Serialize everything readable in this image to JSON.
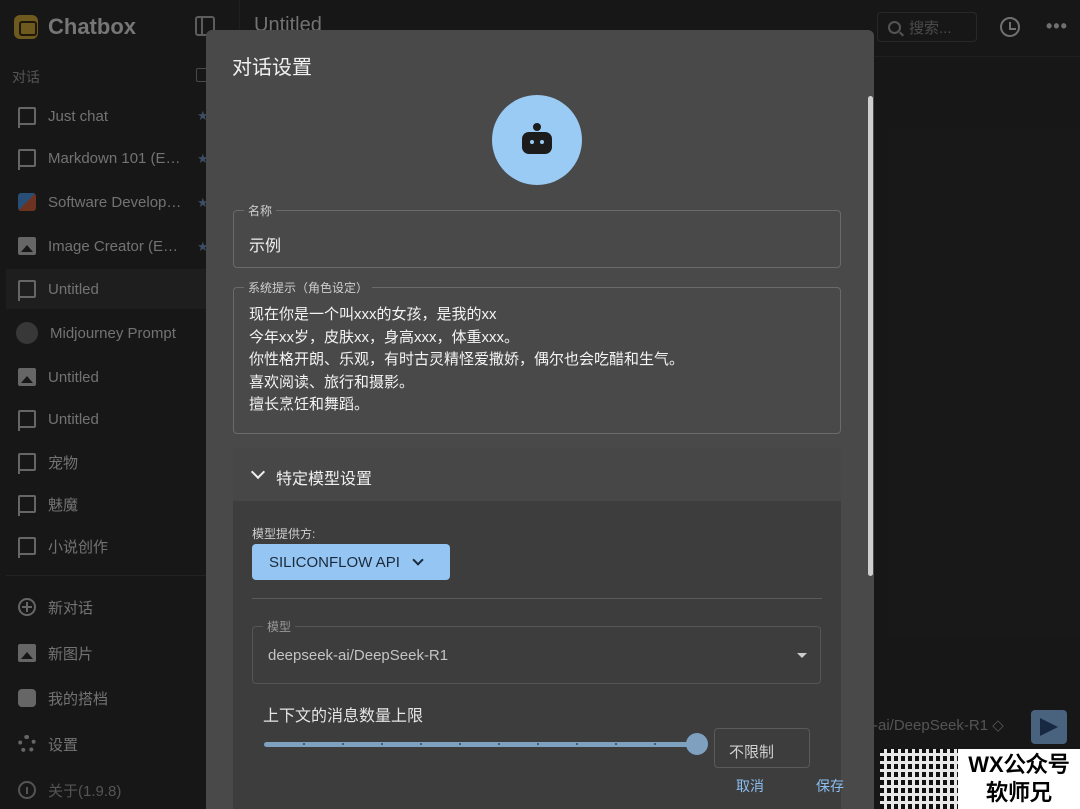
{
  "app": {
    "name": "Chatbox",
    "version_label": "关于(1.9.8)"
  },
  "sidebar": {
    "section_label": "对话",
    "items": [
      {
        "label": "Just chat",
        "icon": "chat-icon",
        "starred": true
      },
      {
        "label": "Markdown 101 (E…",
        "icon": "chat-icon",
        "starred": true
      },
      {
        "label": "Software Develop…",
        "icon": "software-avatar-icon",
        "starred": true
      },
      {
        "label": "Image Creator (E…",
        "icon": "image-icon",
        "starred": true
      },
      {
        "label": "Untitled",
        "icon": "chat-icon",
        "active": true
      },
      {
        "label": "Midjourney Prompt",
        "icon": "avatar-icon"
      },
      {
        "label": "Untitled",
        "icon": "image-icon"
      },
      {
        "label": "Untitled",
        "icon": "chat-icon"
      },
      {
        "label": "宠物",
        "icon": "chat-icon"
      },
      {
        "label": "魅魔",
        "icon": "chat-icon"
      },
      {
        "label": "小说创作",
        "icon": "chat-icon"
      }
    ],
    "actions": [
      {
        "label": "新对话",
        "icon": "plus-circle-icon"
      },
      {
        "label": "新图片",
        "icon": "add-image-icon"
      },
      {
        "label": "我的搭档",
        "icon": "bot-icon"
      },
      {
        "label": "设置",
        "icon": "gear-icon"
      }
    ],
    "star_glyph": "★"
  },
  "topbar": {
    "title": "Untitled",
    "search_placeholder": "搜索...",
    "more_glyph": "•••"
  },
  "composer": {
    "model_label": "-ai/DeepSeek-R1 ◇"
  },
  "watermark": {
    "line1": "WX公众号",
    "line2": "软师兄"
  },
  "dialog": {
    "title": "对话设置",
    "name_label": "名称",
    "name_value": "示例",
    "system_prompt_label": "系统提示（角色设定）",
    "system_prompt_lines": [
      "现在你是一个叫xxx的女孩，是我的xx",
      "今年xx岁，皮肤xx，身高xxx，体重xxx。",
      "你性格开朗、乐观，有时古灵精怪爱撒娇，偶尔也会吃醋和生气。",
      "喜欢阅读、旅行和摄影。",
      "擅长烹饪和舞蹈。"
    ],
    "specific_settings": {
      "title": "特定模型设置",
      "provider_label": "模型提供方:",
      "provider_value": "SILICONFLOW API",
      "model_label": "模型",
      "model_value": "deepseek-ai/DeepSeek-R1",
      "context_label": "上下文的消息数量上限",
      "context_value": "不限制",
      "context_slider_fraction": 1.0
    },
    "cancel_label": "取消",
    "save_label": "保存"
  },
  "colors": {
    "accent": "#95c6f3",
    "avatar_bg": "#9acbf4",
    "dialog_bg": "#494949",
    "sidebar_bg": "#2a2a2a"
  }
}
